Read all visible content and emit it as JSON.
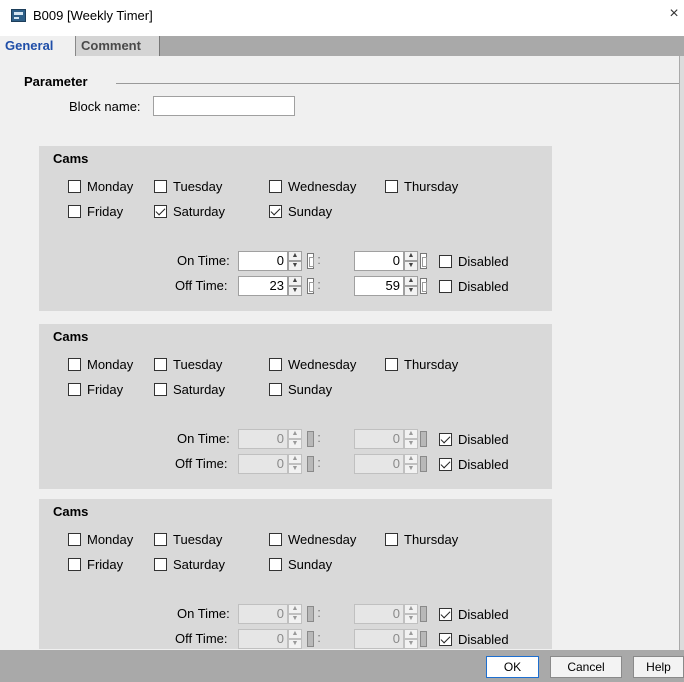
{
  "window": {
    "title": "B009 [Weekly Timer]",
    "close_glyph": "×",
    "icon": "weekly-timer-app-icon"
  },
  "tabs": [
    {
      "label": "General"
    },
    {
      "label": "Comment"
    }
  ],
  "parameter": {
    "section_label": "Parameter",
    "block_name_label": "Block name:",
    "block_name_value": ""
  },
  "cams": [
    {
      "title": "Cams",
      "days": [
        {
          "label": "Monday",
          "checked": false
        },
        {
          "label": "Tuesday",
          "checked": false
        },
        {
          "label": "Wednesday",
          "checked": false
        },
        {
          "label": "Thursday",
          "checked": false
        },
        {
          "label": "Friday",
          "checked": false
        },
        {
          "label": "Saturday",
          "checked": true
        },
        {
          "label": "Sunday",
          "checked": true
        }
      ],
      "on_time": {
        "label": "On Time:",
        "hours": "0",
        "minutes": "0",
        "disabled_label": "Disabled",
        "disabled": false
      },
      "off_time": {
        "label": "Off Time:",
        "hours": "23",
        "minutes": "59",
        "disabled_label": "Disabled",
        "disabled": false
      },
      "separator": ":"
    },
    {
      "title": "Cams",
      "days": [
        {
          "label": "Monday",
          "checked": false
        },
        {
          "label": "Tuesday",
          "checked": false
        },
        {
          "label": "Wednesday",
          "checked": false
        },
        {
          "label": "Thursday",
          "checked": false
        },
        {
          "label": "Friday",
          "checked": false
        },
        {
          "label": "Saturday",
          "checked": false
        },
        {
          "label": "Sunday",
          "checked": false
        }
      ],
      "on_time": {
        "label": "On Time:",
        "hours": "0",
        "minutes": "0",
        "disabled_label": "Disabled",
        "disabled": true
      },
      "off_time": {
        "label": "Off Time:",
        "hours": "0",
        "minutes": "0",
        "disabled_label": "Disabled",
        "disabled": true
      },
      "separator": ":"
    },
    {
      "title": "Cams",
      "days": [
        {
          "label": "Monday",
          "checked": false
        },
        {
          "label": "Tuesday",
          "checked": false
        },
        {
          "label": "Wednesday",
          "checked": false
        },
        {
          "label": "Thursday",
          "checked": false
        },
        {
          "label": "Friday",
          "checked": false
        },
        {
          "label": "Saturday",
          "checked": false
        },
        {
          "label": "Sunday",
          "checked": false
        }
      ],
      "on_time": {
        "label": "On Time:",
        "hours": "0",
        "minutes": "0",
        "disabled_label": "Disabled",
        "disabled": true
      },
      "off_time": {
        "label": "Off Time:",
        "hours": "0",
        "minutes": "0",
        "disabled_label": "Disabled",
        "disabled": true
      },
      "separator": ":"
    }
  ],
  "footer": {
    "ok_label": "OK",
    "cancel_label": "Cancel",
    "help_label": "Help"
  },
  "colors": {
    "panel": "#d9d9d9",
    "background": "#f0f0f0",
    "bar": "#a9a9a9",
    "tab_active_text": "#1f4ea8",
    "ok_border": "#1e6fd0"
  }
}
